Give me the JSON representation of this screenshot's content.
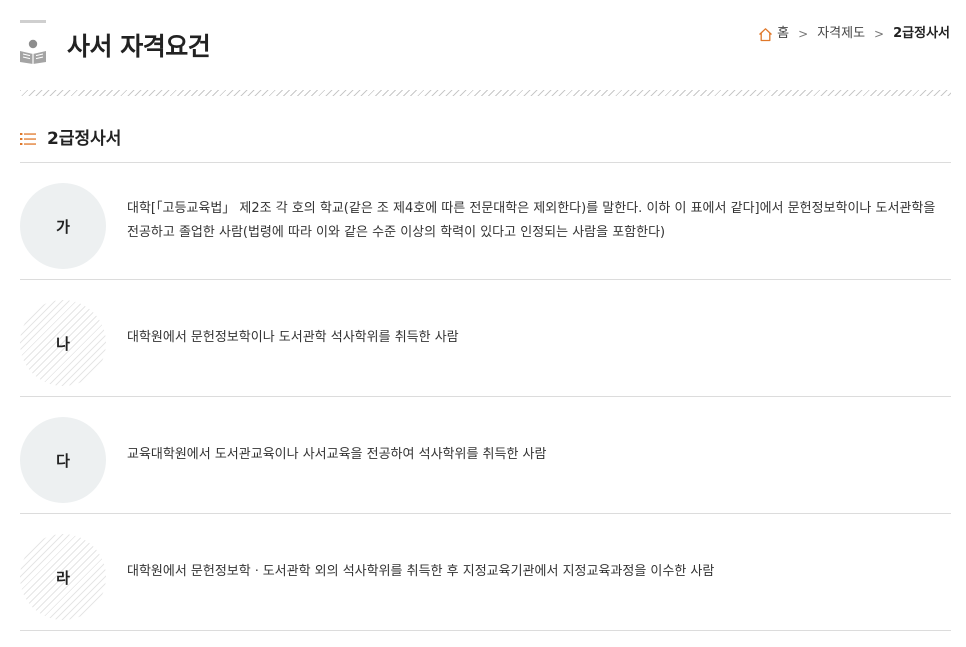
{
  "header": {
    "title": "사서 자격요건"
  },
  "breadcrumb": {
    "home": "홈",
    "level1": "자격제도",
    "current": "2급정사서"
  },
  "section": {
    "title": "2급정사서"
  },
  "items": [
    {
      "badge": "가",
      "text": "대학[「고등교육법」 제2조 각 호의 학교(같은 조 제4호에 따른 전문대학은 제외한다)를 말한다. 이하 이 표에서 같다]에서 문헌정보학이나 도서관학을 전공하고 졸업한 사람(법령에 따라 이와 같은 수준 이상의 학력이 있다고 인정되는 사람을 포함한다)"
    },
    {
      "badge": "나",
      "text": "대학원에서 문헌정보학이나 도서관학 석사학위를 취득한 사람"
    },
    {
      "badge": "다",
      "text": "교육대학원에서 도서관교육이나 사서교육을 전공하여 석사학위를 취득한 사람"
    },
    {
      "badge": "라",
      "text": "대학원에서 문헌정보학ㆍ도서관학 외의 석사학위를 취득한 후 지정교육기관에서 지정교육과정을 이수한 사람"
    }
  ],
  "icons": {
    "title": "reading-person-icon",
    "home": "home-icon",
    "section": "list-icon"
  }
}
